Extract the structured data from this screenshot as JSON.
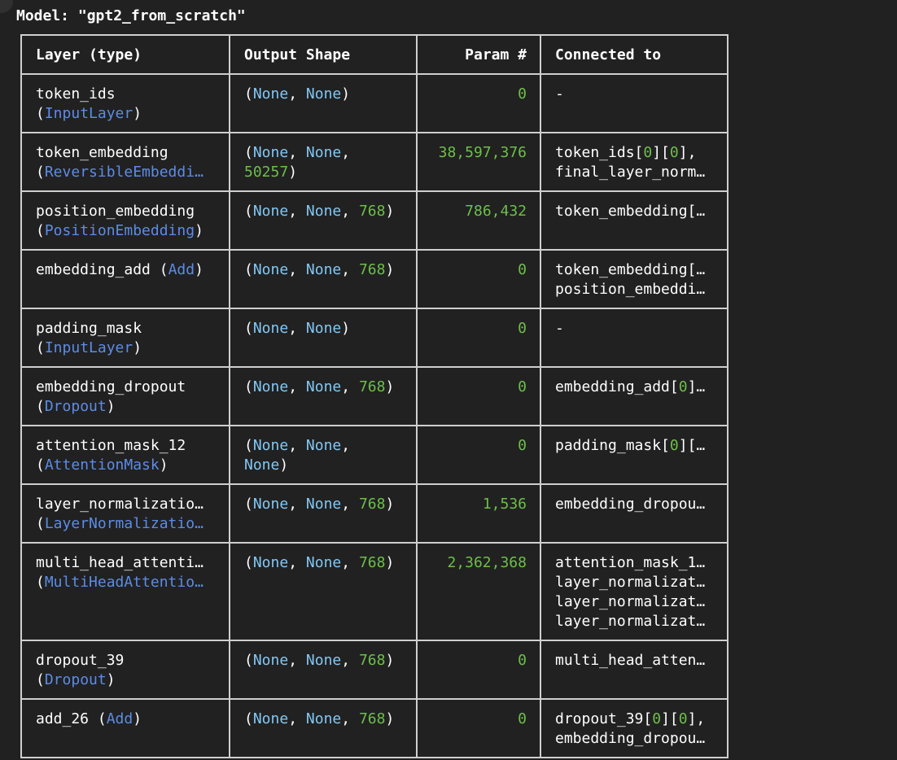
{
  "title": "Model: \"gpt2_from_scratch\"",
  "headers": {
    "layer": "Layer (type)",
    "shape": "Output Shape",
    "params": "Param #",
    "connected": "Connected to"
  },
  "rows": [
    {
      "layer_name": "token_ids",
      "layer_type": "InputLayer",
      "layer_type_truncated": false,
      "same_line": false,
      "shape": [
        [
          "(",
          "None",
          ", ",
          "None",
          ")"
        ]
      ],
      "params": "0",
      "connected": [
        [
          "-"
        ]
      ]
    },
    {
      "layer_name": "token_embedding",
      "layer_type": "ReversibleEmbeddi…",
      "layer_type_truncated": true,
      "same_line": false,
      "shape": [
        [
          "(",
          "None",
          ", ",
          "None",
          ","
        ],
        [
          "50257",
          ")"
        ]
      ],
      "params": "38,597,376",
      "connected": [
        [
          "token_ids[",
          "0",
          "][",
          "0",
          "],"
        ],
        [
          "final_layer_norm…"
        ]
      ]
    },
    {
      "layer_name": "position_embedding",
      "layer_type": "PositionEmbedding",
      "layer_type_truncated": false,
      "same_line": false,
      "shape": [
        [
          "(",
          "None",
          ", ",
          "None",
          ", ",
          "768",
          ")"
        ]
      ],
      "params": "786,432",
      "connected": [
        [
          "token_embedding[…"
        ]
      ]
    },
    {
      "layer_name": "embedding_add",
      "layer_type": "Add",
      "layer_type_truncated": false,
      "same_line": true,
      "shape": [
        [
          "(",
          "None",
          ", ",
          "None",
          ", ",
          "768",
          ")"
        ]
      ],
      "params": "0",
      "connected": [
        [
          "token_embedding[…"
        ],
        [
          "position_embeddi…"
        ]
      ]
    },
    {
      "layer_name": "padding_mask",
      "layer_type": "InputLayer",
      "layer_type_truncated": false,
      "same_line": false,
      "shape": [
        [
          "(",
          "None",
          ", ",
          "None",
          ")"
        ]
      ],
      "params": "0",
      "connected": [
        [
          "-"
        ]
      ]
    },
    {
      "layer_name": "embedding_dropout",
      "layer_type": "Dropout",
      "layer_type_truncated": false,
      "same_line": false,
      "shape": [
        [
          "(",
          "None",
          ", ",
          "None",
          ", ",
          "768",
          ")"
        ]
      ],
      "params": "0",
      "connected": [
        [
          "embedding_add[",
          "0",
          "]…"
        ]
      ]
    },
    {
      "layer_name": "attention_mask_12",
      "layer_type": "AttentionMask",
      "layer_type_truncated": false,
      "same_line": false,
      "shape": [
        [
          "(",
          "None",
          ", ",
          "None",
          ","
        ],
        [
          "None",
          ")"
        ]
      ],
      "params": "0",
      "connected": [
        [
          "padding_mask[",
          "0",
          "][…"
        ]
      ]
    },
    {
      "layer_name": "layer_normalizatio…",
      "layer_type": "LayerNormalizatio…",
      "layer_type_truncated": true,
      "same_line": false,
      "shape": [
        [
          "(",
          "None",
          ", ",
          "None",
          ", ",
          "768",
          ")"
        ]
      ],
      "params": "1,536",
      "connected": [
        [
          "embedding_dropou…"
        ]
      ]
    },
    {
      "layer_name": "multi_head_attenti…",
      "layer_type": "MultiHeadAttentio…",
      "layer_type_truncated": true,
      "same_line": false,
      "shape": [
        [
          "(",
          "None",
          ", ",
          "None",
          ", ",
          "768",
          ")"
        ]
      ],
      "params": "2,362,368",
      "connected": [
        [
          "attention_mask_1…"
        ],
        [
          "layer_normalizat…"
        ],
        [
          "layer_normalizat…"
        ],
        [
          "layer_normalizat…"
        ]
      ]
    },
    {
      "layer_name": "dropout_39",
      "layer_type": "Dropout",
      "layer_type_truncated": false,
      "same_line": false,
      "shape": [
        [
          "(",
          "None",
          ", ",
          "None",
          ", ",
          "768",
          ")"
        ]
      ],
      "params": "0",
      "connected": [
        [
          "multi_head_atten…"
        ]
      ]
    },
    {
      "layer_name": "add_26",
      "layer_type": "Add",
      "layer_type_truncated": false,
      "same_line": true,
      "shape": [
        [
          "(",
          "None",
          ", ",
          "None",
          ", ",
          "768",
          ")"
        ]
      ],
      "params": "0",
      "connected": [
        [
          "dropout_39[",
          "0",
          "][",
          "0",
          "],"
        ],
        [
          "embedding_dropou…"
        ]
      ]
    }
  ]
}
